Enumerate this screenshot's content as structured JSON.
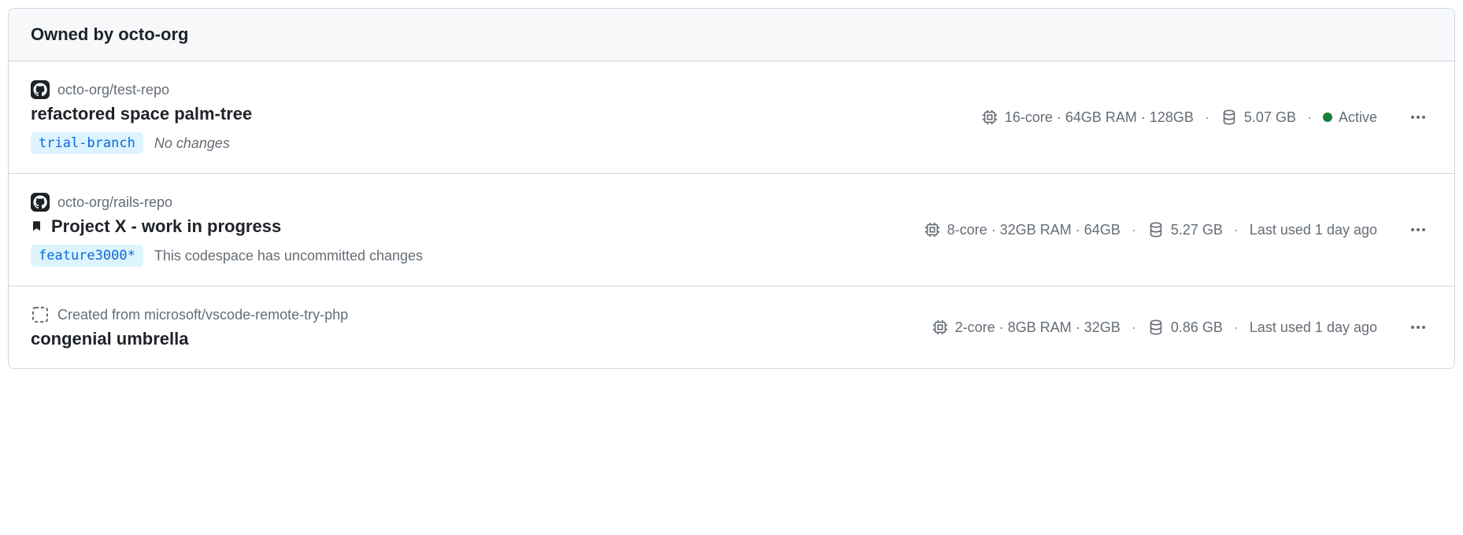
{
  "header": {
    "title": "Owned by octo-org"
  },
  "codespaces": [
    {
      "repo": "octo-org/test-repo",
      "template_prefix": null,
      "has_avatar": true,
      "bookmarked": false,
      "name": "refactored space palm-tree",
      "branch": "trial-branch",
      "changes": "No changes",
      "changes_italic": true,
      "machine": "16-core · 64GB RAM · 128GB",
      "storage": "5.07 GB",
      "status_text": "Active",
      "status_active": true
    },
    {
      "repo": "octo-org/rails-repo",
      "template_prefix": null,
      "has_avatar": true,
      "bookmarked": true,
      "name": "Project X - work in progress",
      "branch": "feature3000*",
      "changes": "This codespace has uncommitted changes",
      "changes_italic": false,
      "machine": "8-core · 32GB RAM · 64GB",
      "storage": "5.27 GB",
      "status_text": "Last used 1 day ago",
      "status_active": false
    },
    {
      "repo": "microsoft/vscode-remote-try-php",
      "template_prefix": "Created from ",
      "has_avatar": false,
      "bookmarked": false,
      "name": "congenial umbrella",
      "branch": null,
      "changes": null,
      "changes_italic": false,
      "machine": "2-core · 8GB RAM · 32GB",
      "storage": "0.86 GB",
      "status_text": "Last used 1 day ago",
      "status_active": false
    }
  ],
  "icons": {
    "github": "github-icon",
    "template": "template-repo-icon",
    "bookmark": "bookmark-icon",
    "cpu": "cpu-icon",
    "database": "database-icon",
    "kebab": "kebab-horizontal-icon"
  }
}
